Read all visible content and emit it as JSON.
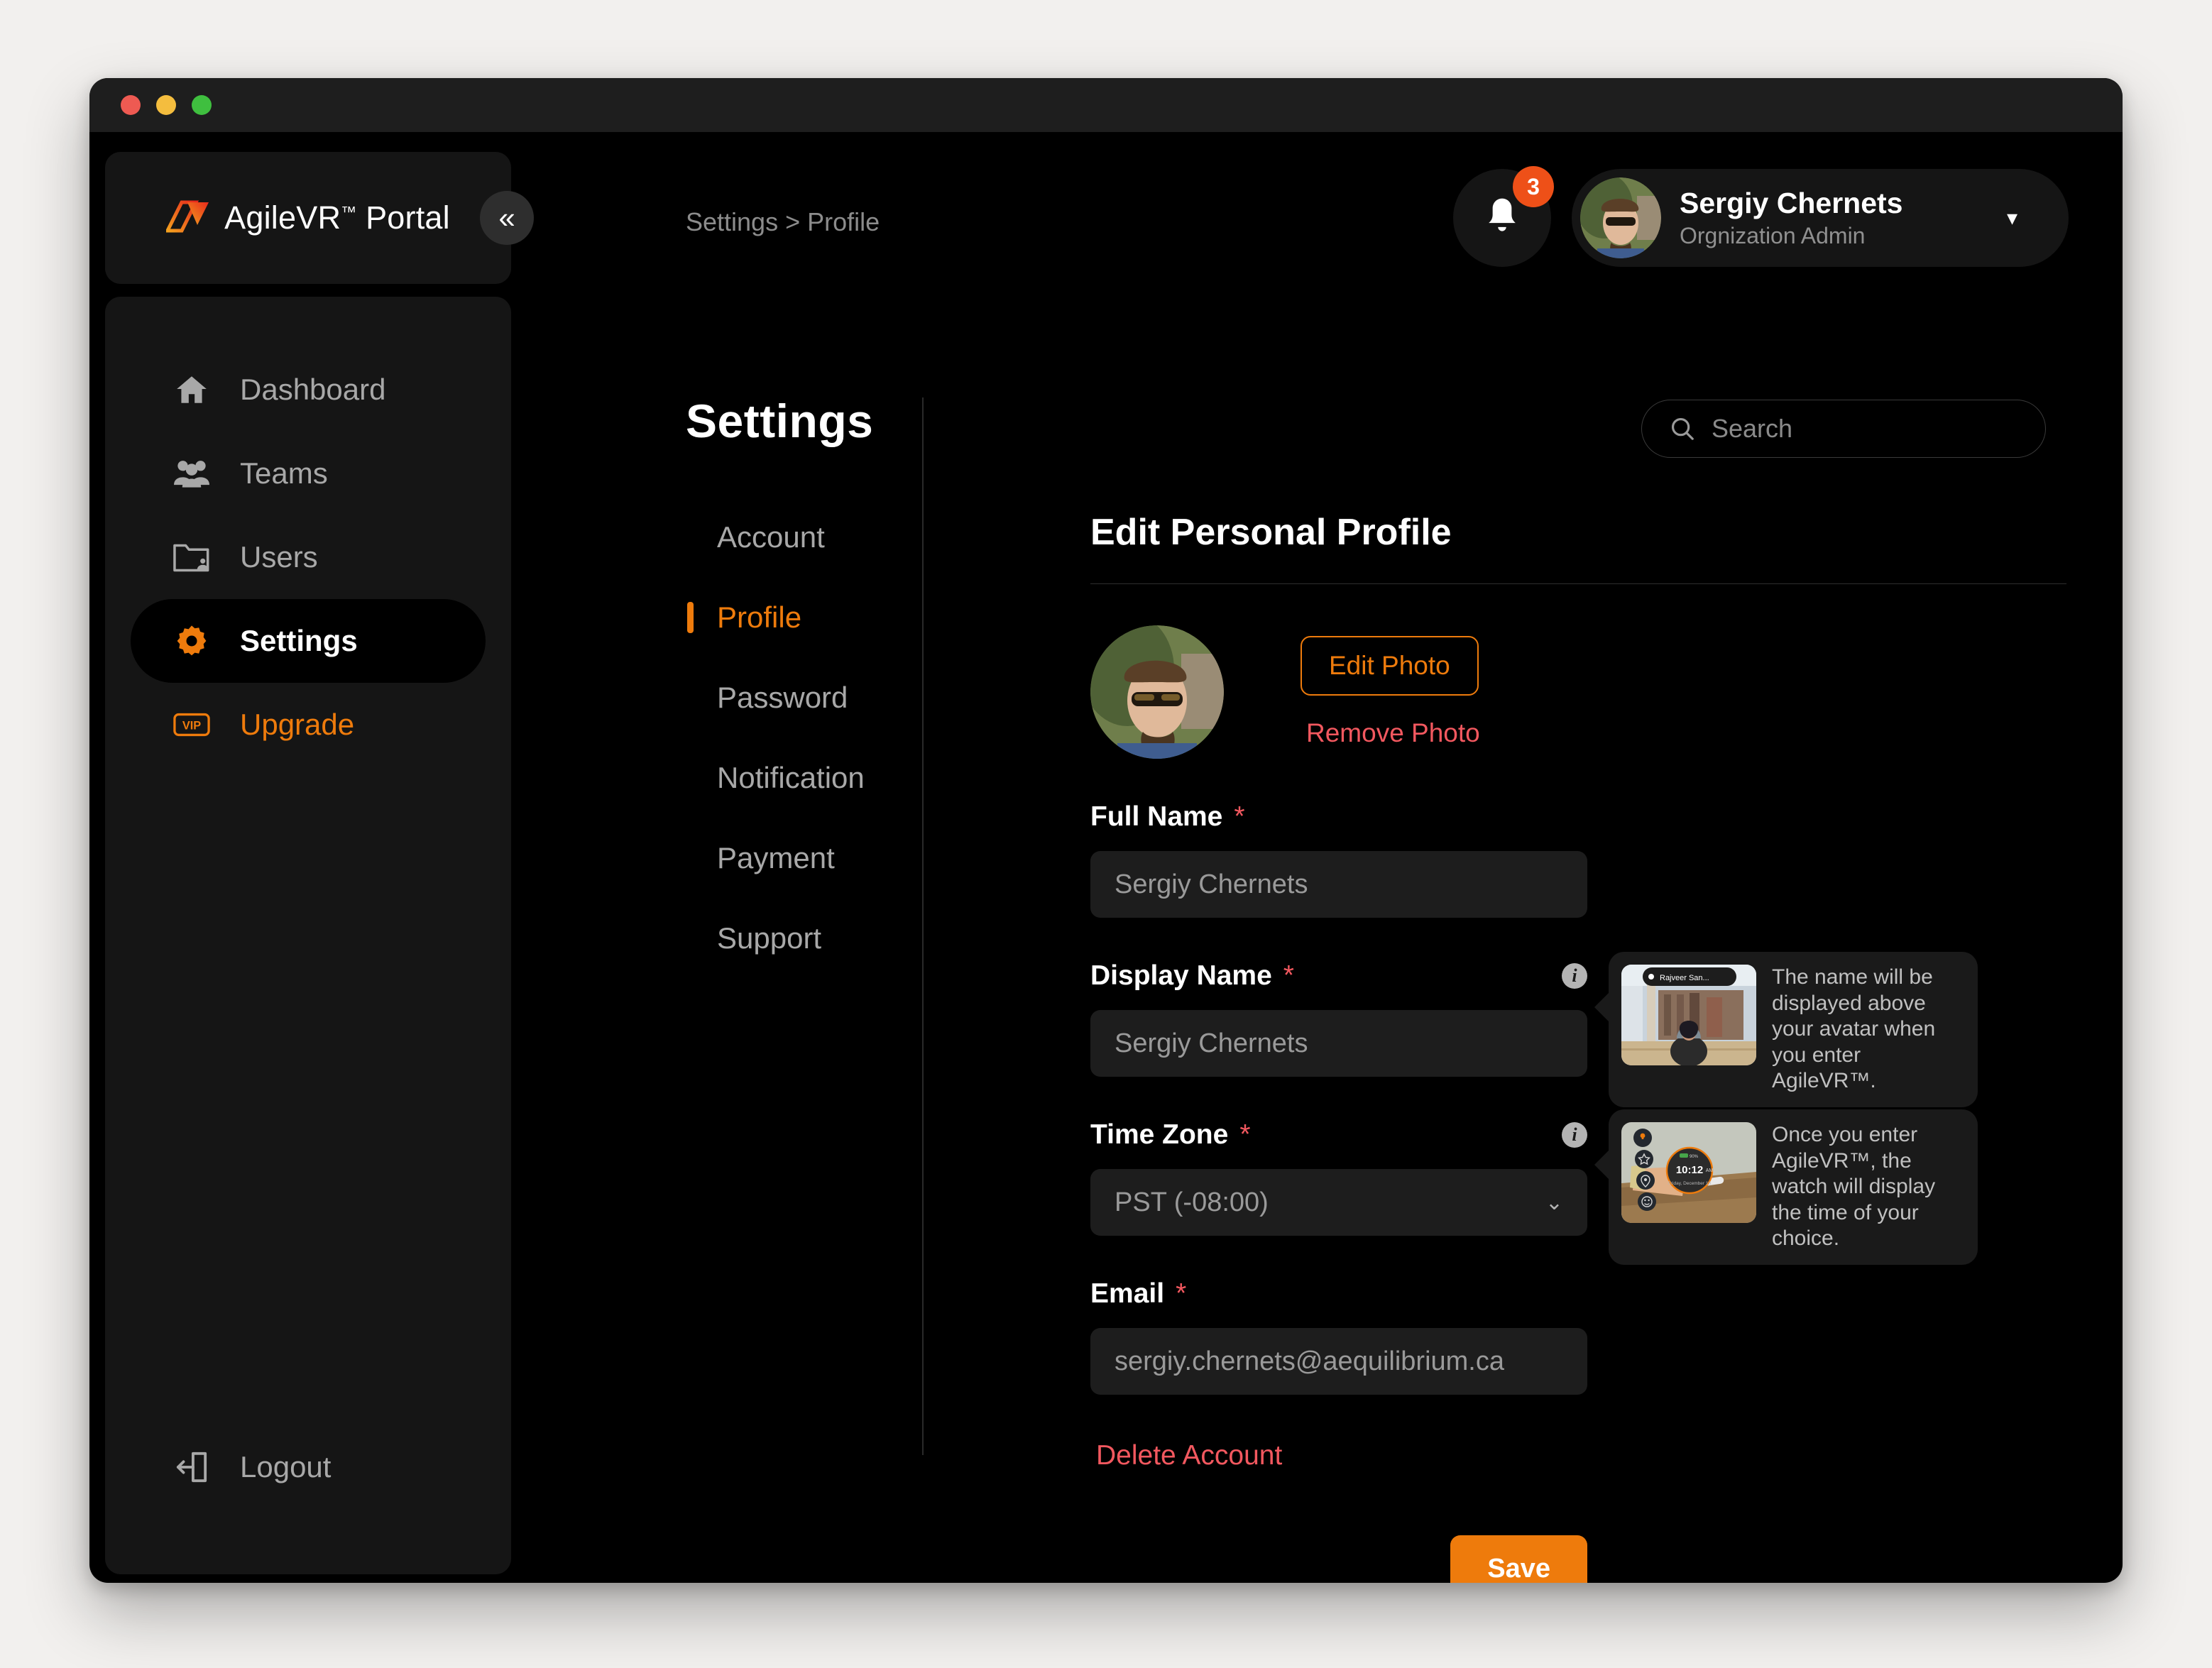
{
  "brand": {
    "name": "AgileVR",
    "tm": "™",
    "suffix": "Portal",
    "accent": "#ee7b0c"
  },
  "window": {
    "collapse_icon": "«"
  },
  "topbar": {
    "breadcrumb": "Settings > Profile",
    "notification_count": "3",
    "user_name": "Sergiy Chernets",
    "user_role": "Orgnization Admin",
    "caret": "▾"
  },
  "sidebar": {
    "items": [
      {
        "label": "Dashboard",
        "icon": "home-icon"
      },
      {
        "label": "Teams",
        "icon": "people-icon"
      },
      {
        "label": "Users",
        "icon": "folder-user-icon"
      },
      {
        "label": "Settings",
        "icon": "gear-icon"
      },
      {
        "label": "Upgrade",
        "icon": "vip-badge-icon"
      }
    ],
    "logout": {
      "label": "Logout",
      "icon": "logout-icon"
    }
  },
  "settings": {
    "title": "Settings",
    "tabs": [
      {
        "label": "Account"
      },
      {
        "label": "Profile"
      },
      {
        "label": "Password"
      },
      {
        "label": "Notification"
      },
      {
        "label": "Payment"
      },
      {
        "label": "Support"
      }
    ]
  },
  "search": {
    "placeholder": "Search"
  },
  "profile": {
    "heading": "Edit Personal Profile",
    "edit_photo_label": "Edit Photo",
    "remove_photo_label": "Remove Photo",
    "delete_account_label": "Delete Account",
    "save_label": "Save",
    "fields": {
      "full_name": {
        "label": "Full Name",
        "required": "*",
        "value": "Sergiy Chernets"
      },
      "display_name": {
        "label": "Display Name",
        "required": "*",
        "value": "Sergiy Chernets"
      },
      "time_zone": {
        "label": "Time Zone",
        "required": "*",
        "value": "PST (-08:00)",
        "chevron": "⌄"
      },
      "email": {
        "label": "Email",
        "required": "*",
        "value": "sergiy.chernets@aequilibrium.ca"
      }
    },
    "tooltips": {
      "display_name": "The name will be displayed above your avatar when you enter AgileVR™.",
      "time_zone": "Once you enter AgileVR™, the watch will display the time of your choice.",
      "vr_nameplate": "Rajveer San...",
      "watch_time": "10:12",
      "watch_ampm": "AM",
      "watch_date": "Friday, December 16",
      "watch_battery": "90%"
    },
    "info_glyph": "i"
  },
  "colors": {
    "accent_orange": "#ee7b0c",
    "danger_red": "#f2585f",
    "badge_orange": "#ee5018",
    "window_bg": "#000000",
    "panel_bg": "#151515",
    "input_bg": "#1d1d1d"
  }
}
